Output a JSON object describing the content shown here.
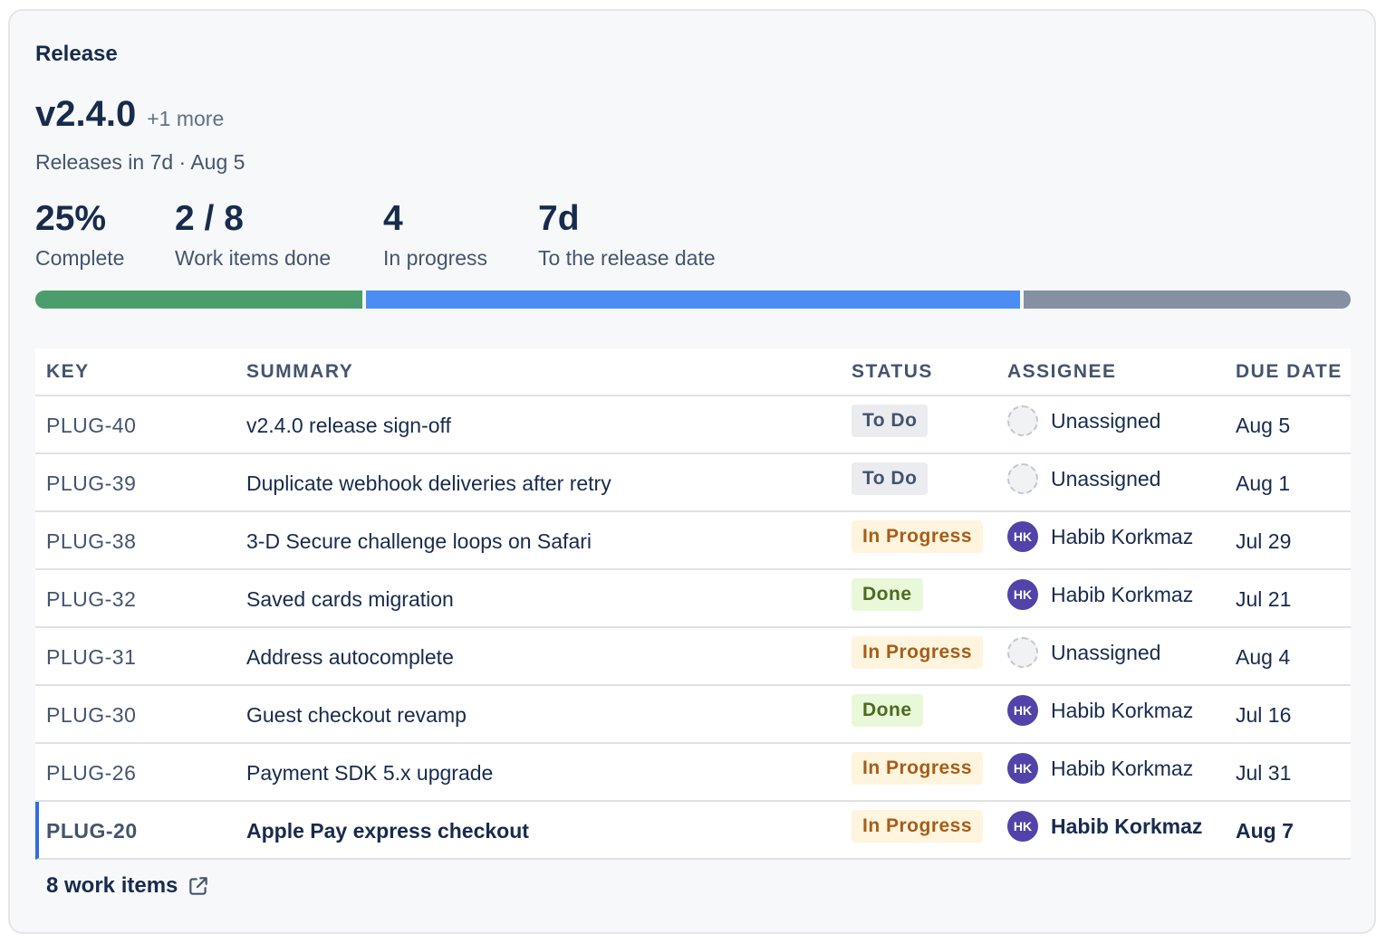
{
  "release": {
    "section_label": "Release",
    "version": "v2.4.0",
    "more": "+1 more",
    "meta": "Releases in 7d · Aug 5"
  },
  "stats": [
    {
      "value": "25%",
      "label": "Complete"
    },
    {
      "value": "2 / 8",
      "label": "Work items done"
    },
    {
      "value": "4",
      "label": "In progress"
    },
    {
      "value": "7d",
      "label": "To the release date"
    }
  ],
  "progress": {
    "done": 2,
    "in_progress": 4,
    "to_do": 2,
    "total": 8,
    "colors": {
      "done": "#4b9e6b",
      "in_progress": "#4c8cf5",
      "to_do": "#8590a2"
    }
  },
  "table": {
    "headers": {
      "key": "KEY",
      "summary": "SUMMARY",
      "status": "STATUS",
      "assignee": "ASSIGNEE",
      "due": "DUE DATE"
    },
    "rows": [
      {
        "key": "PLUG-40",
        "summary": "v2.4.0 release sign-off",
        "status": "To Do",
        "assignee": "Unassigned",
        "initials": "",
        "due": "Aug 5"
      },
      {
        "key": "PLUG-39",
        "summary": "Duplicate webhook deliveries after retry",
        "status": "To Do",
        "assignee": "Unassigned",
        "initials": "",
        "due": "Aug 1"
      },
      {
        "key": "PLUG-38",
        "summary": "3-D Secure challenge loops on Safari",
        "status": "In Progress",
        "assignee": "Habib Korkmaz",
        "initials": "HK",
        "due": "Jul 29"
      },
      {
        "key": "PLUG-32",
        "summary": "Saved cards migration",
        "status": "Done",
        "assignee": "Habib Korkmaz",
        "initials": "HK",
        "due": "Jul 21"
      },
      {
        "key": "PLUG-31",
        "summary": "Address autocomplete",
        "status": "In Progress",
        "assignee": "Unassigned",
        "initials": "",
        "due": "Aug 4"
      },
      {
        "key": "PLUG-30",
        "summary": "Guest checkout revamp",
        "status": "Done",
        "assignee": "Habib Korkmaz",
        "initials": "HK",
        "due": "Jul 16"
      },
      {
        "key": "PLUG-26",
        "summary": "Payment SDK 5.x upgrade",
        "status": "In Progress",
        "assignee": "Habib Korkmaz",
        "initials": "HK",
        "due": "Jul 31"
      },
      {
        "key": "PLUG-20",
        "summary": "Apple Pay express checkout",
        "status": "In Progress",
        "assignee": "Habib Korkmaz",
        "initials": "HK",
        "due": "Aug 7",
        "selected": true
      }
    ]
  },
  "footer": {
    "label": "8 work items",
    "icon": "external-link-icon"
  }
}
